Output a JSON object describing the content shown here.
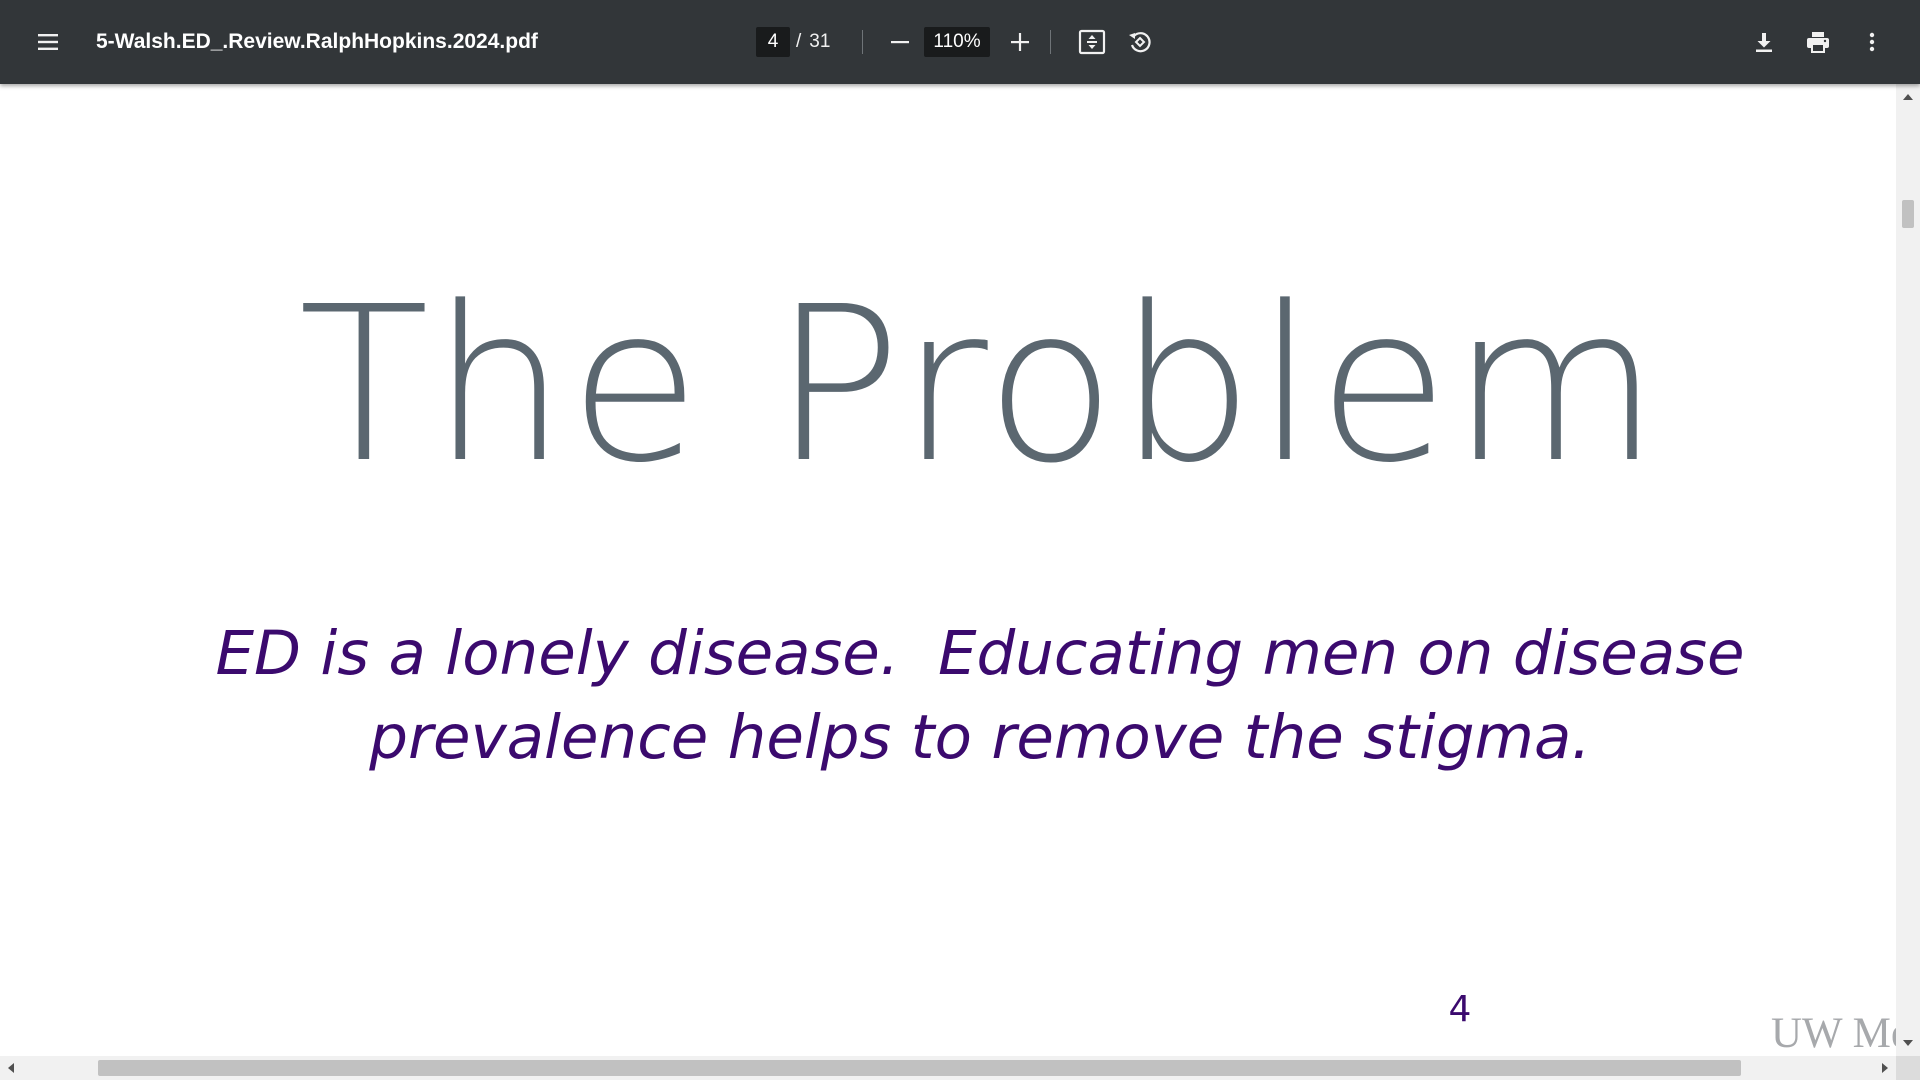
{
  "toolbar": {
    "menu_icon": "hamburger-menu-icon",
    "filename": "5-Walsh.ED_.Review.RalphHopkins.2024.pdf",
    "page": {
      "current": "4",
      "separator": "/",
      "total": "31"
    },
    "zoom": {
      "value": "110%",
      "zoom_out_icon": "minus-icon",
      "zoom_in_icon": "plus-icon"
    },
    "fit_icon": "fit-to-page-icon",
    "rotate_icon": "rotate-counterclockwise-icon",
    "download_icon": "download-icon",
    "print_icon": "print-icon",
    "more_icon": "more-vertical-icon"
  },
  "slide": {
    "title": "The Problem",
    "body_lines": [
      "ED is a lonely disease.  Educating men on disease",
      "prevalence helps to remove the stigma."
    ],
    "page_number": "4",
    "watermark": "UW Med"
  },
  "colors": {
    "toolbar_bg": "#323639",
    "title": "#5b6770",
    "body": "#3b0a6e",
    "watermark": "#a7a9ac"
  }
}
